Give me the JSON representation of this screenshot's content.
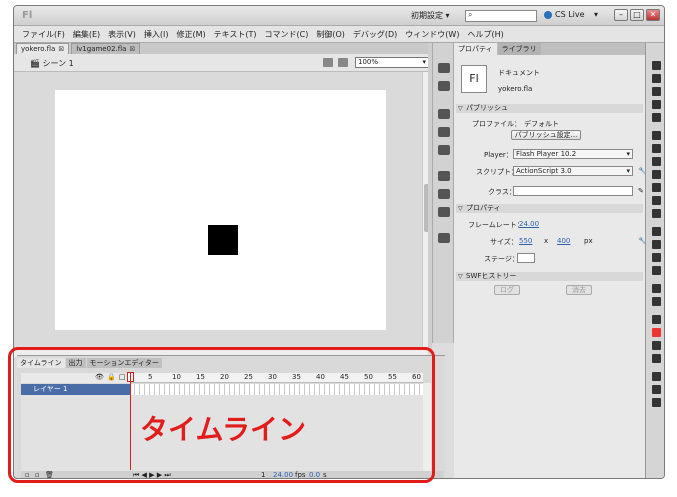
{
  "app": {
    "logo": "Fl",
    "workspace": "初期設定",
    "search_placeholder": "",
    "cs_live": "CS Live"
  },
  "menu": [
    "ファイル(F)",
    "編集(E)",
    "表示(V)",
    "挿入(I)",
    "修正(M)",
    "テキスト(T)",
    "コマンド(C)",
    "制御(O)",
    "デバッグ(D)",
    "ウィンドウ(W)",
    "ヘルプ(H)"
  ],
  "doc_tabs": [
    {
      "label": "yokero.fla"
    },
    {
      "label": "lv1game02.fla"
    }
  ],
  "scene": {
    "label": "シーン 1",
    "zoom": "100%"
  },
  "panel": {
    "tabs": [
      "プロパティ",
      "ライブラリ"
    ],
    "doc_icon": "Fl",
    "doc_type": "ドキュメント",
    "doc_name": "yokero.fla",
    "publish_header": "パブリッシュ",
    "profile_label": "プロファイル：",
    "profile_value": "デフォルト",
    "publish_settings_btn": "パブリッシュ設定...",
    "player_label": "Player：",
    "player_value": "Flash Player 10.2",
    "script_label": "スクリプト：",
    "script_value": "ActionScript 3.0",
    "class_label": "クラス：",
    "props_header": "プロパティ",
    "fps_label": "フレームレート：",
    "fps_value": "24.00",
    "size_label": "サイズ：",
    "width_value": "550",
    "x_label": "x",
    "height_value": "400",
    "px_label": "px",
    "stage_label": "ステージ：",
    "swf_header": "SWFヒストリー",
    "log_btn": "ログ",
    "clear_btn": "消去"
  },
  "timeline": {
    "tabs": [
      "タイムライン",
      "出力",
      "モーションエディター"
    ],
    "layer_name": "レイヤー 1",
    "ruler": [
      "5",
      "10",
      "15",
      "20",
      "25",
      "30",
      "35",
      "40",
      "45",
      "50",
      "55",
      "60"
    ],
    "fps": "24.00",
    "fps_unit": "fps",
    "time": "0.0",
    "time_unit": "s",
    "frame": "1"
  },
  "annotation": {
    "label": "タイムライン",
    "color": "#e21b1b"
  }
}
